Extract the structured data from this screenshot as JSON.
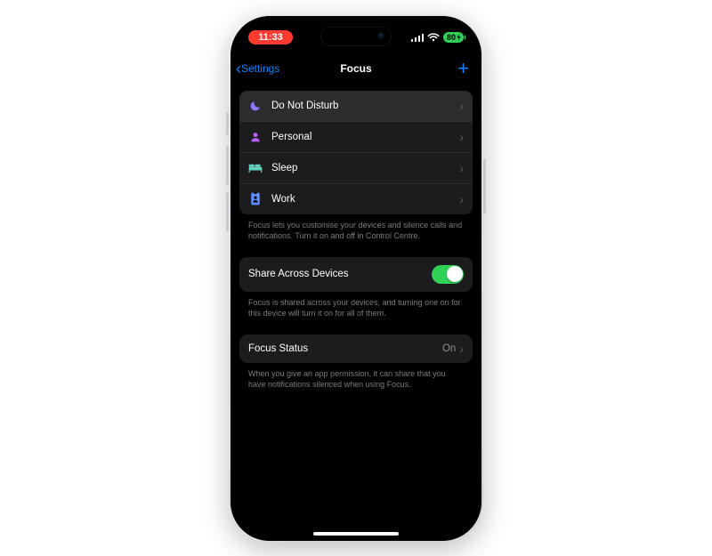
{
  "status": {
    "time": "11:33",
    "battery": "80"
  },
  "nav": {
    "back_label": "Settings",
    "title": "Focus"
  },
  "modes": [
    {
      "icon": "moon-icon",
      "color": "#8e75ff",
      "label": "Do Not Disturb",
      "highlight": true
    },
    {
      "icon": "person-icon",
      "color": "#b95eff",
      "label": "Personal"
    },
    {
      "icon": "bed-icon",
      "color": "#64d2c0",
      "label": "Sleep"
    },
    {
      "icon": "badge-icon",
      "color": "#5e8eff",
      "label": "Work"
    }
  ],
  "modes_footer": "Focus lets you customise your devices and silence calls and notifications. Turn it on and off in Control Centre.",
  "share": {
    "label": "Share Across Devices",
    "on": true,
    "footer": "Focus is shared across your devices, and turning one on for this device will turn it on for all of them."
  },
  "status_row": {
    "label": "Focus Status",
    "value": "On",
    "footer": "When you give an app permission, it can share that you have notifications silenced when using Focus."
  }
}
